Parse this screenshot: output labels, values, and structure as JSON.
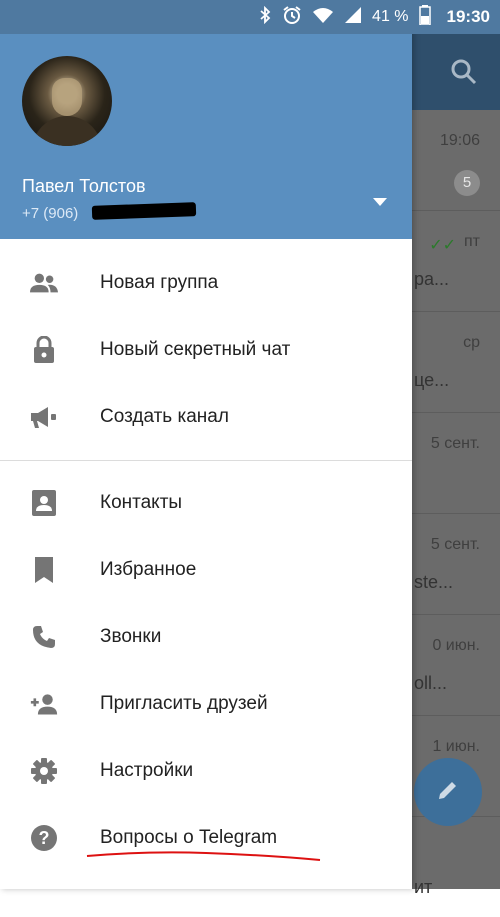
{
  "status_bar": {
    "battery_percent": "41 %",
    "time": "19:30",
    "icons": [
      "bluetooth-icon",
      "alarm-icon",
      "wifi-icon",
      "signal-icon",
      "battery-icon"
    ]
  },
  "drawer": {
    "user_name": "Павел Толстов",
    "phone": "+7 (906)",
    "menu_groups": [
      [
        {
          "label": "Новая группа",
          "icon": "new-group-icon"
        },
        {
          "label": "Новый секретный чат",
          "icon": "lock-icon"
        },
        {
          "label": "Создать канал",
          "icon": "megaphone-icon"
        }
      ],
      [
        {
          "label": "Контакты",
          "icon": "contacts-icon"
        },
        {
          "label": "Избранное",
          "icon": "bookmark-icon"
        },
        {
          "label": "Звонки",
          "icon": "phone-icon"
        },
        {
          "label": "Пригласить друзей",
          "icon": "add-person-icon"
        },
        {
          "label": "Настройки",
          "icon": "settings-icon"
        },
        {
          "label": "Вопросы о Telegram",
          "icon": "help-icon"
        }
      ]
    ]
  },
  "background_chats": [
    {
      "time": "19:06",
      "badge": "5",
      "preview": ""
    },
    {
      "time": "пт",
      "preview": "ра..."
    },
    {
      "time": "ср",
      "preview": "це..."
    },
    {
      "time": "5 сент.",
      "preview": ""
    },
    {
      "time": "5 сент.",
      "preview": "ste..."
    },
    {
      "time": "0 июн.",
      "preview": "oll..."
    },
    {
      "time": "1 июн.",
      "preview": ""
    },
    {
      "time": "",
      "preview": "ит"
    }
  ],
  "colors": {
    "drawer_header": "#5a8fc0",
    "status_bar": "#4f79a0",
    "appbar": "#2f4f6c",
    "fab": "#3d6f9a",
    "icon_gray": "#757575"
  }
}
